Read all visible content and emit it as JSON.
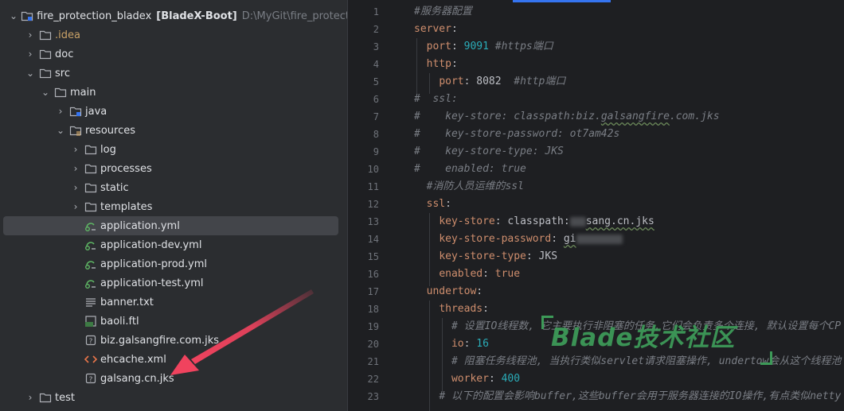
{
  "project": {
    "name": "fire_protection_bladex",
    "module": "[BladeX-Boot]",
    "path": "D:\\MyGit\\fire_protection\\fir"
  },
  "tree": [
    {
      "label": ".idea",
      "type": "folder",
      "chevron": "right"
    },
    {
      "label": "doc",
      "type": "folder",
      "chevron": "right"
    },
    {
      "label": "src",
      "type": "folder",
      "chevron": "down"
    },
    {
      "label": "main",
      "type": "folder",
      "chevron": "down"
    },
    {
      "label": "java",
      "type": "folder-blue",
      "chevron": "right"
    },
    {
      "label": "resources",
      "type": "folder-res",
      "chevron": "down"
    },
    {
      "label": "log",
      "type": "folder",
      "chevron": "right"
    },
    {
      "label": "processes",
      "type": "folder",
      "chevron": "right"
    },
    {
      "label": "static",
      "type": "folder",
      "chevron": "right"
    },
    {
      "label": "templates",
      "type": "folder",
      "chevron": "right"
    },
    {
      "label": "application.yml",
      "type": "yml"
    },
    {
      "label": "application-dev.yml",
      "type": "yml"
    },
    {
      "label": "application-prod.yml",
      "type": "yml"
    },
    {
      "label": "application-test.yml",
      "type": "yml"
    },
    {
      "label": "banner.txt",
      "type": "txt"
    },
    {
      "label": "baoli.ftl",
      "type": "ftl"
    },
    {
      "label": "biz.galsangfire.com.jks",
      "type": "unknown"
    },
    {
      "label": "ehcache.xml",
      "type": "xml"
    },
    {
      "label": "galsang.cn.jks",
      "type": "unknown"
    },
    {
      "label": "test",
      "type": "folder",
      "chevron": "right"
    }
  ],
  "editor": {
    "line_numbers": [
      "1",
      "2",
      "3",
      "4",
      "5",
      "6",
      "7",
      "8",
      "9",
      "10",
      "11",
      "12",
      "13",
      "14",
      "15",
      "16",
      "17",
      "18",
      "19",
      "20",
      "21",
      "22",
      "23"
    ],
    "lines": {
      "l1": "#服务器配置",
      "l2_key": "server",
      "l3_key": "port",
      "l3_val": "9091",
      "l3_cmt": "#https端口",
      "l4_key": "http",
      "l5_key": "port",
      "l5_val": "8082",
      "l5_cmt": "#http端口",
      "l6": "#  ssl:",
      "l7_hash": "#",
      "l7_a": "key-store: classpath:biz.",
      "l7_b": "galsangfire",
      "l7_c": ".com.jks",
      "l8_hash": "#",
      "l8": "key-store-password: ot7am42s",
      "l9_hash": "#",
      "l9": "key-store-type: JKS",
      "l10_hash": "#",
      "l10": "enabled: true",
      "l11": "#消防人员运维的ssl",
      "l12_key": "ssl",
      "l13_key": "key-store",
      "l13_val_a": "classpath:",
      "l13_val_b": "sang.cn.jks",
      "l14_key": "key-store-password",
      "l14_val": "gi",
      "l15_key": "key-store-type",
      "l15_val": "JKS",
      "l16_key": "enabled",
      "l16_val": "true",
      "l17_key": "undertow",
      "l18_key": "threads",
      "l19": "# 设置IO线程数, 它主要执行非阻塞的任务,它们会负责多个连接, 默认设置每个CP",
      "l20_key": "io",
      "l20_val": "16",
      "l21": "# 阻塞任务线程池, 当执行类似servlet请求阻塞操作, undertow会从这个线程池",
      "l22_key": "worker",
      "l22_val": "400",
      "l23": "# 以下的配置会影响buffer,这些buffer会用于服务器连接的IO操作,有点类似netty"
    }
  },
  "watermark": "Blade技术社区",
  "colors": {
    "accent": "#3574f0",
    "keyword": "#cf8e6d",
    "number": "#2aacb8",
    "comment": "#7a7e85",
    "watermark": "#3d9a58",
    "arrow": "#f0435e"
  }
}
